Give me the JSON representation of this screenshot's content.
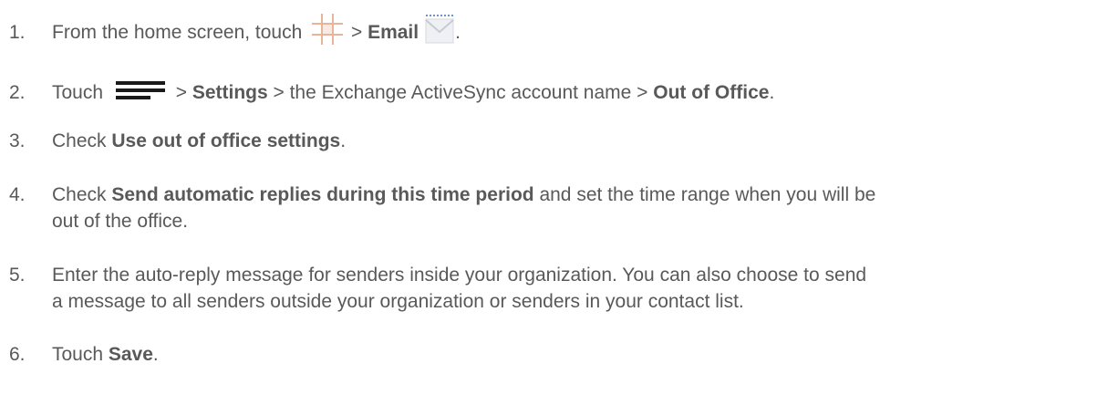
{
  "steps": [
    {
      "number": "1.",
      "parts": [
        "From the home screen, touch ",
        " > ",
        "Email",
        "."
      ],
      "icons": [
        "apps-grid-icon",
        "email-envelope-icon"
      ]
    },
    {
      "number": "2.",
      "parts": [
        "Touch ",
        " > ",
        "Settings",
        " > the Exchange ActiveSync account name > ",
        "Out of Office",
        "."
      ],
      "icons": [
        "menu-icon"
      ]
    },
    {
      "number": "3.",
      "parts": [
        "Check ",
        "Use out of office settings",
        "."
      ]
    },
    {
      "number": "4.",
      "parts": [
        "Check ",
        "Send automatic replies during this time period",
        " and set the time range when you will be",
        "out of the office."
      ]
    },
    {
      "number": "5.",
      "parts": [
        "Enter the auto-reply message for senders inside your organization. You can also choose to send",
        "a message to all senders outside your organization or senders in your contact list."
      ]
    },
    {
      "number": "6.",
      "parts": [
        "Touch ",
        "Save",
        "."
      ]
    }
  ],
  "colors": {
    "text": "#595959",
    "grid_icon": "#e8b59a",
    "envelope_icon": "#c8ccd2",
    "menu_icon": "#1a1a1a"
  }
}
